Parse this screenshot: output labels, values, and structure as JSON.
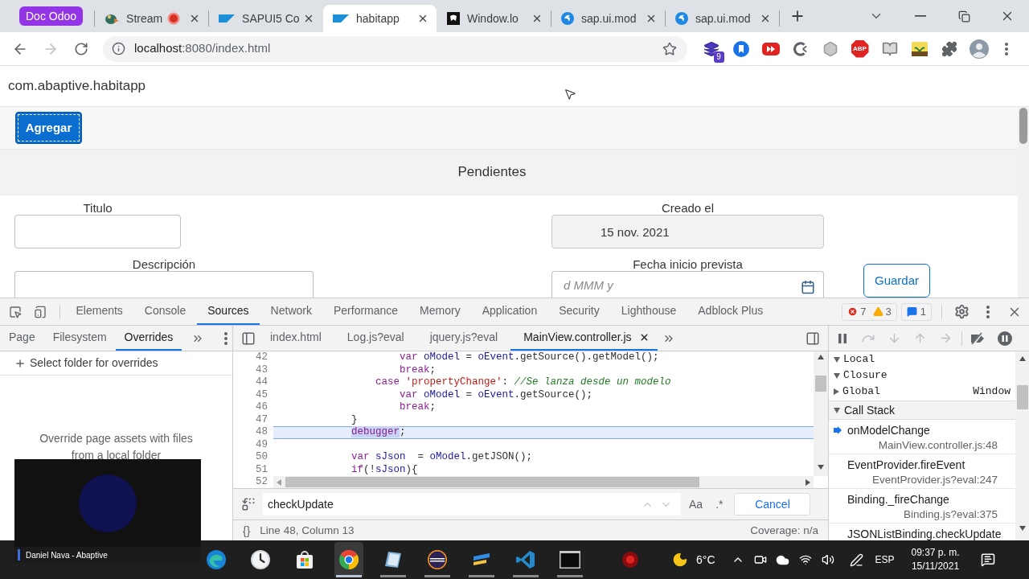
{
  "browser": {
    "tab_group": {
      "label": "Doc Odoo"
    },
    "tabs": [
      {
        "kind": "stream",
        "title": "Stream",
        "recording": true,
        "selected": false
      },
      {
        "kind": "sap",
        "title": "SAPUI5 Co",
        "recording": false,
        "selected": false
      },
      {
        "kind": "sap",
        "title": "habitapp",
        "recording": false,
        "selected": true
      },
      {
        "kind": "dark",
        "title": "Window.lo",
        "recording": false,
        "selected": false
      },
      {
        "kind": "globe",
        "title": "sap.ui.mod",
        "recording": false,
        "selected": false
      },
      {
        "kind": "globe",
        "title": "sap.ui.mod",
        "recording": false,
        "selected": false
      }
    ],
    "navigation": {
      "back_disabled": false,
      "forward_disabled": true
    },
    "address": {
      "host": "localhost",
      "path": ":8080/index.html"
    },
    "extensions": [
      {
        "kind": "stack",
        "badge": "9"
      },
      {
        "kind": "bookmark"
      },
      {
        "kind": "play"
      },
      {
        "kind": "crescent"
      },
      {
        "kind": "hexagon"
      },
      {
        "kind": "adblock",
        "label": "ABP"
      },
      {
        "kind": "book"
      },
      {
        "kind": "plant"
      },
      {
        "kind": "puzzle"
      },
      {
        "kind": "avatar"
      }
    ]
  },
  "app": {
    "title": "com.abaptive.habitapp",
    "add_button": {
      "label": "Agregar",
      "focused": true
    },
    "section_title": "Pendientes",
    "form": {
      "left": [
        {
          "label": "Titulo",
          "kind": "text",
          "disabled": false
        },
        {
          "label": "Descripción",
          "kind": "text",
          "disabled": false
        }
      ],
      "right": [
        {
          "label": "Creado el",
          "kind": "text",
          "value": "15 nov. 2021",
          "disabled": true
        },
        {
          "label": "Fecha inicio prevista",
          "kind": "date",
          "placeholder": "d MMM y",
          "disabled": false
        }
      ]
    },
    "save_button": "Guardar"
  },
  "devtools": {
    "tabs": [
      {
        "label": "Elements",
        "selected": false
      },
      {
        "label": "Console",
        "selected": false
      },
      {
        "label": "Sources",
        "selected": true
      },
      {
        "label": "Network",
        "selected": false
      },
      {
        "label": "Performance",
        "selected": false
      },
      {
        "label": "Memory",
        "selected": false
      },
      {
        "label": "Application",
        "selected": false
      },
      {
        "label": "Security",
        "selected": false
      },
      {
        "label": "Lighthouse",
        "selected": false
      },
      {
        "label": "Adblock Plus",
        "selected": false
      }
    ],
    "issues": {
      "errors": "7",
      "warnings": "3",
      "messages": "1"
    },
    "navigator": {
      "tabs": [
        {
          "label": "Page",
          "selected": false
        },
        {
          "label": "Filesystem",
          "selected": false
        },
        {
          "label": "Overrides",
          "selected": true
        }
      ],
      "action": "Select folder for overrides",
      "empty_message": "Override page assets with files from a local folder"
    },
    "editor": {
      "tabs": [
        {
          "label": "index.html",
          "selected": false
        },
        {
          "label": "Log.js?eval",
          "selected": false
        },
        {
          "label": "jquery.js?eval",
          "selected": false
        },
        {
          "label": "MainView.controller.js",
          "selected": true
        }
      ],
      "lines": [
        {
          "number": "42",
          "highlighted": false,
          "tokens": [
            {
              "kind": "keyword",
              "text": "                    var"
            },
            {
              "kind": "variable",
              "text": " oModel"
            },
            {
              "kind": "plain",
              "text": " = "
            },
            {
              "kind": "variable",
              "text": "oEvent"
            },
            {
              "kind": "plain",
              "text": ".getSource().getModel();"
            }
          ]
        },
        {
          "number": "43",
          "highlighted": false,
          "tokens": [
            {
              "kind": "keyword",
              "text": "                    break"
            },
            {
              "kind": "plain",
              "text": ";"
            }
          ]
        },
        {
          "number": "44",
          "highlighted": false,
          "tokens": [
            {
              "kind": "keyword",
              "text": "                case"
            },
            {
              "kind": "string",
              "text": " 'propertyChange'"
            },
            {
              "kind": "plain",
              "text": ": "
            },
            {
              "kind": "comment",
              "text": "//Se lanza desde un modelo"
            }
          ]
        },
        {
          "number": "45",
          "highlighted": false,
          "tokens": [
            {
              "kind": "keyword",
              "text": "                    var"
            },
            {
              "kind": "variable",
              "text": " oModel"
            },
            {
              "kind": "plain",
              "text": " = "
            },
            {
              "kind": "variable",
              "text": "oEvent"
            },
            {
              "kind": "plain",
              "text": ".getSource();"
            }
          ]
        },
        {
          "number": "46",
          "highlighted": false,
          "tokens": [
            {
              "kind": "keyword",
              "text": "                    break"
            },
            {
              "kind": "plain",
              "text": ";"
            }
          ]
        },
        {
          "number": "47",
          "highlighted": false,
          "tokens": [
            {
              "kind": "plain",
              "text": "            }"
            }
          ]
        },
        {
          "number": "48",
          "highlighted": true,
          "tokens": [
            {
              "kind": "selection",
              "text": "            debugger"
            },
            {
              "kind": "plain",
              "text": ";"
            }
          ]
        },
        {
          "number": "49",
          "highlighted": false
        },
        {
          "number": "50",
          "highlighted": false,
          "tokens": [
            {
              "kind": "keyword",
              "text": "            var"
            },
            {
              "kind": "variable",
              "text": " sJson"
            },
            {
              "kind": "plain",
              "text": "  = "
            },
            {
              "kind": "variable",
              "text": "oModel"
            },
            {
              "kind": "plain",
              "text": ".getJSON();"
            }
          ]
        },
        {
          "number": "51",
          "highlighted": false,
          "tokens": [
            {
              "kind": "keyword",
              "text": "            if"
            },
            {
              "kind": "plain",
              "text": "(!"
            },
            {
              "kind": "variable",
              "text": "sJson"
            },
            {
              "kind": "plain",
              "text": "){"
            }
          ]
        },
        {
          "number": "52",
          "highlighted": false
        }
      ],
      "search": {
        "value": "checkUpdate",
        "case_toggle": "Aa",
        "regex_toggle": ".*",
        "cancel": "Cancel"
      },
      "status": {
        "format_button": "{}",
        "position": "Line 48, Column 13",
        "coverage": "Coverage: n/a"
      }
    },
    "debugger": {
      "scope": [
        {
          "name": "Local",
          "expanded": true
        },
        {
          "name": "Closure",
          "expanded": true
        },
        {
          "name": "Global",
          "expanded": false,
          "value": "Window"
        }
      ],
      "call_stack": {
        "title": "Call Stack",
        "expanded": true,
        "frames": [
          {
            "function": "onModelChange",
            "location": "MainView.controller.js:48",
            "selected": true
          },
          {
            "function": "EventProvider.fireEvent",
            "location": "EventProvider.js?eval:247",
            "selected": false
          },
          {
            "function": "Binding._fireChange",
            "location": "Binding.js?eval:375",
            "selected": false
          },
          {
            "function": "JSONListBinding.checkUpdate",
            "selected": false
          }
        ]
      }
    }
  },
  "webcam": {
    "caption": "Daniel Nava - Abaptive"
  },
  "taskbar": {
    "apps": [
      {
        "kind": "edge",
        "running": false,
        "active": false
      },
      {
        "kind": "clock",
        "running": false,
        "active": false
      },
      {
        "kind": "store",
        "running": false,
        "active": false
      },
      {
        "kind": "chrome",
        "running": true,
        "active": true
      },
      {
        "kind": "notebook",
        "running": true,
        "active": false
      },
      {
        "kind": "eclipse",
        "running": true,
        "active": false
      },
      {
        "kind": "editor",
        "running": true,
        "active": false
      },
      {
        "kind": "vscode",
        "running": true,
        "active": false
      },
      {
        "kind": "terminal",
        "running": true,
        "active": false
      },
      {
        "kind": "record",
        "running": false,
        "active": false
      }
    ],
    "temperature": "6°C",
    "language": "ESP",
    "time": "09:37 p. m.",
    "date": "15/11/2021"
  }
}
